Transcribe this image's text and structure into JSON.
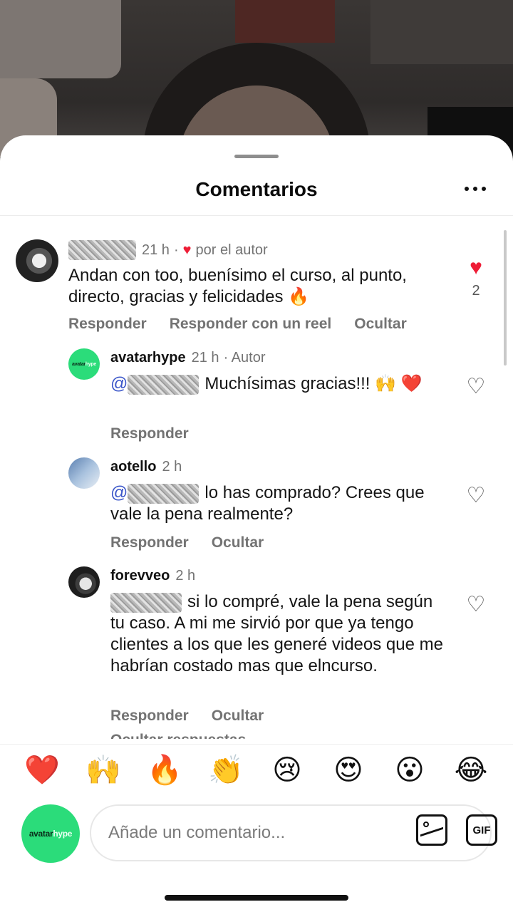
{
  "header": {
    "title": "Comentarios"
  },
  "comments": [
    {
      "time": "21 h",
      "author_tag": "por el autor",
      "text": "Andan con too, buenísimo el curso, al punto, directo, gracias y felicidades 🔥",
      "actions": [
        "Responder",
        "Responder con un reel",
        "Ocultar"
      ],
      "likes": "2"
    }
  ],
  "replies": [
    {
      "username": "avatarhype",
      "time": "21 h",
      "author_tag": "· Autor",
      "mention": "@",
      "text": "Muchísimas gracias!!! 🙌 ❤️",
      "actions": [
        "Responder"
      ]
    },
    {
      "username": "aotello",
      "time": "2 h",
      "mention": "@",
      "text": "lo has comprado? Crees que vale la pena realmente?",
      "actions": [
        "Responder",
        "Ocultar"
      ]
    },
    {
      "username": "forevveo",
      "time": "2 h",
      "text": "si lo compré, vale la pena según tu caso. A mi me sirvió por que ya tengo clientes a los que les generé videos que me habrían costado mas que elncurso.",
      "actions": [
        "Responder",
        "Ocultar"
      ],
      "partial_link": "Ocultar respuestas"
    }
  ],
  "emoji_bar": [
    "❤️",
    "🙌",
    "🔥",
    "👏",
    "😢",
    "😍",
    "😮",
    "😂"
  ],
  "compose": {
    "avatar_logo_a": "avatar",
    "avatar_logo_b": "hype",
    "placeholder": "Añade un comentario...",
    "gif_label": "GIF"
  },
  "colors": {
    "accent_heart": "#ee1d36",
    "mention": "#3a55c9",
    "avatar_green": "#2bdc7a"
  }
}
